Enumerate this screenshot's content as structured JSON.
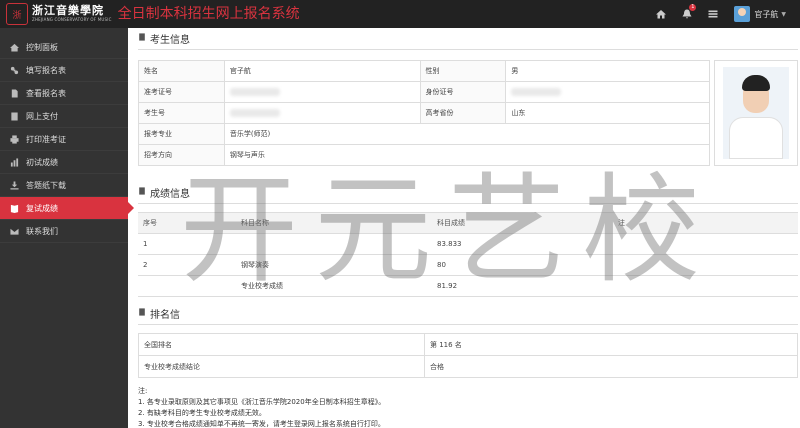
{
  "header": {
    "logo_mark": "浙",
    "logo_cn": "浙江音樂學院",
    "logo_en": "ZHEJIANG CONSERVATORY OF MUSIC",
    "system_title": "全日制本科招生网上报名系统",
    "notification_count": "1",
    "user_name": "官子航"
  },
  "sidebar": {
    "items": [
      {
        "label": "控制面板",
        "icon": "dashboard-icon"
      },
      {
        "label": "填写报名表",
        "icon": "pencil-icon"
      },
      {
        "label": "查看报名表",
        "icon": "document-icon"
      },
      {
        "label": "网上支付",
        "icon": "card-icon"
      },
      {
        "label": "打印准考证",
        "icon": "print-icon"
      },
      {
        "label": "初试成绩",
        "icon": "chart-icon"
      },
      {
        "label": "答题纸下载",
        "icon": "download-icon"
      },
      {
        "label": "复试成绩",
        "icon": "book-icon"
      },
      {
        "label": "联系我们",
        "icon": "mail-icon"
      }
    ],
    "active_index": 7
  },
  "candidate": {
    "section_title": "考生信息",
    "name_label": "姓名",
    "name": "官子航",
    "gender_label": "性别",
    "gender": "男",
    "ticket_label": "准考证号",
    "id_label": "身份证号",
    "exam_no_label": "考生号",
    "province_label": "高考省份",
    "province": "山东",
    "major_label": "报考专业",
    "major": "音乐学(师范)",
    "direction_label": "招考方向",
    "direction": "钢琴与声乐"
  },
  "scores": {
    "section_title": "成绩信息",
    "columns": [
      "序号",
      "科目名称",
      "科目成绩",
      "注"
    ],
    "rows": [
      {
        "no": "1",
        "subject": "",
        "score": "83.833"
      },
      {
        "no": "2",
        "subject": "钢琴演奏",
        "score": "80"
      },
      {
        "no": "",
        "subject": "专业校考成绩",
        "score": "81.92"
      }
    ]
  },
  "ranking": {
    "section_title": "排名信",
    "rank_label": "全国排名",
    "rank_value": "第 116 名",
    "conclusion_label": "专业校考成绩结论",
    "conclusion_value": "合格"
  },
  "notes": {
    "title": "注:",
    "lines": [
      "1. 各专业录取原则及其它事项见《浙江音乐学院2020年全日制本科招生章程》。",
      "2. 有缺考科目的考生专业校考成绩无效。",
      "3. 专业校考合格成绩通知单不再统一寄发，请考生登录网上报名系统自行打印。"
    ]
  },
  "watermark": {
    "chars": [
      "开",
      "元",
      "艺",
      "校"
    ]
  }
}
